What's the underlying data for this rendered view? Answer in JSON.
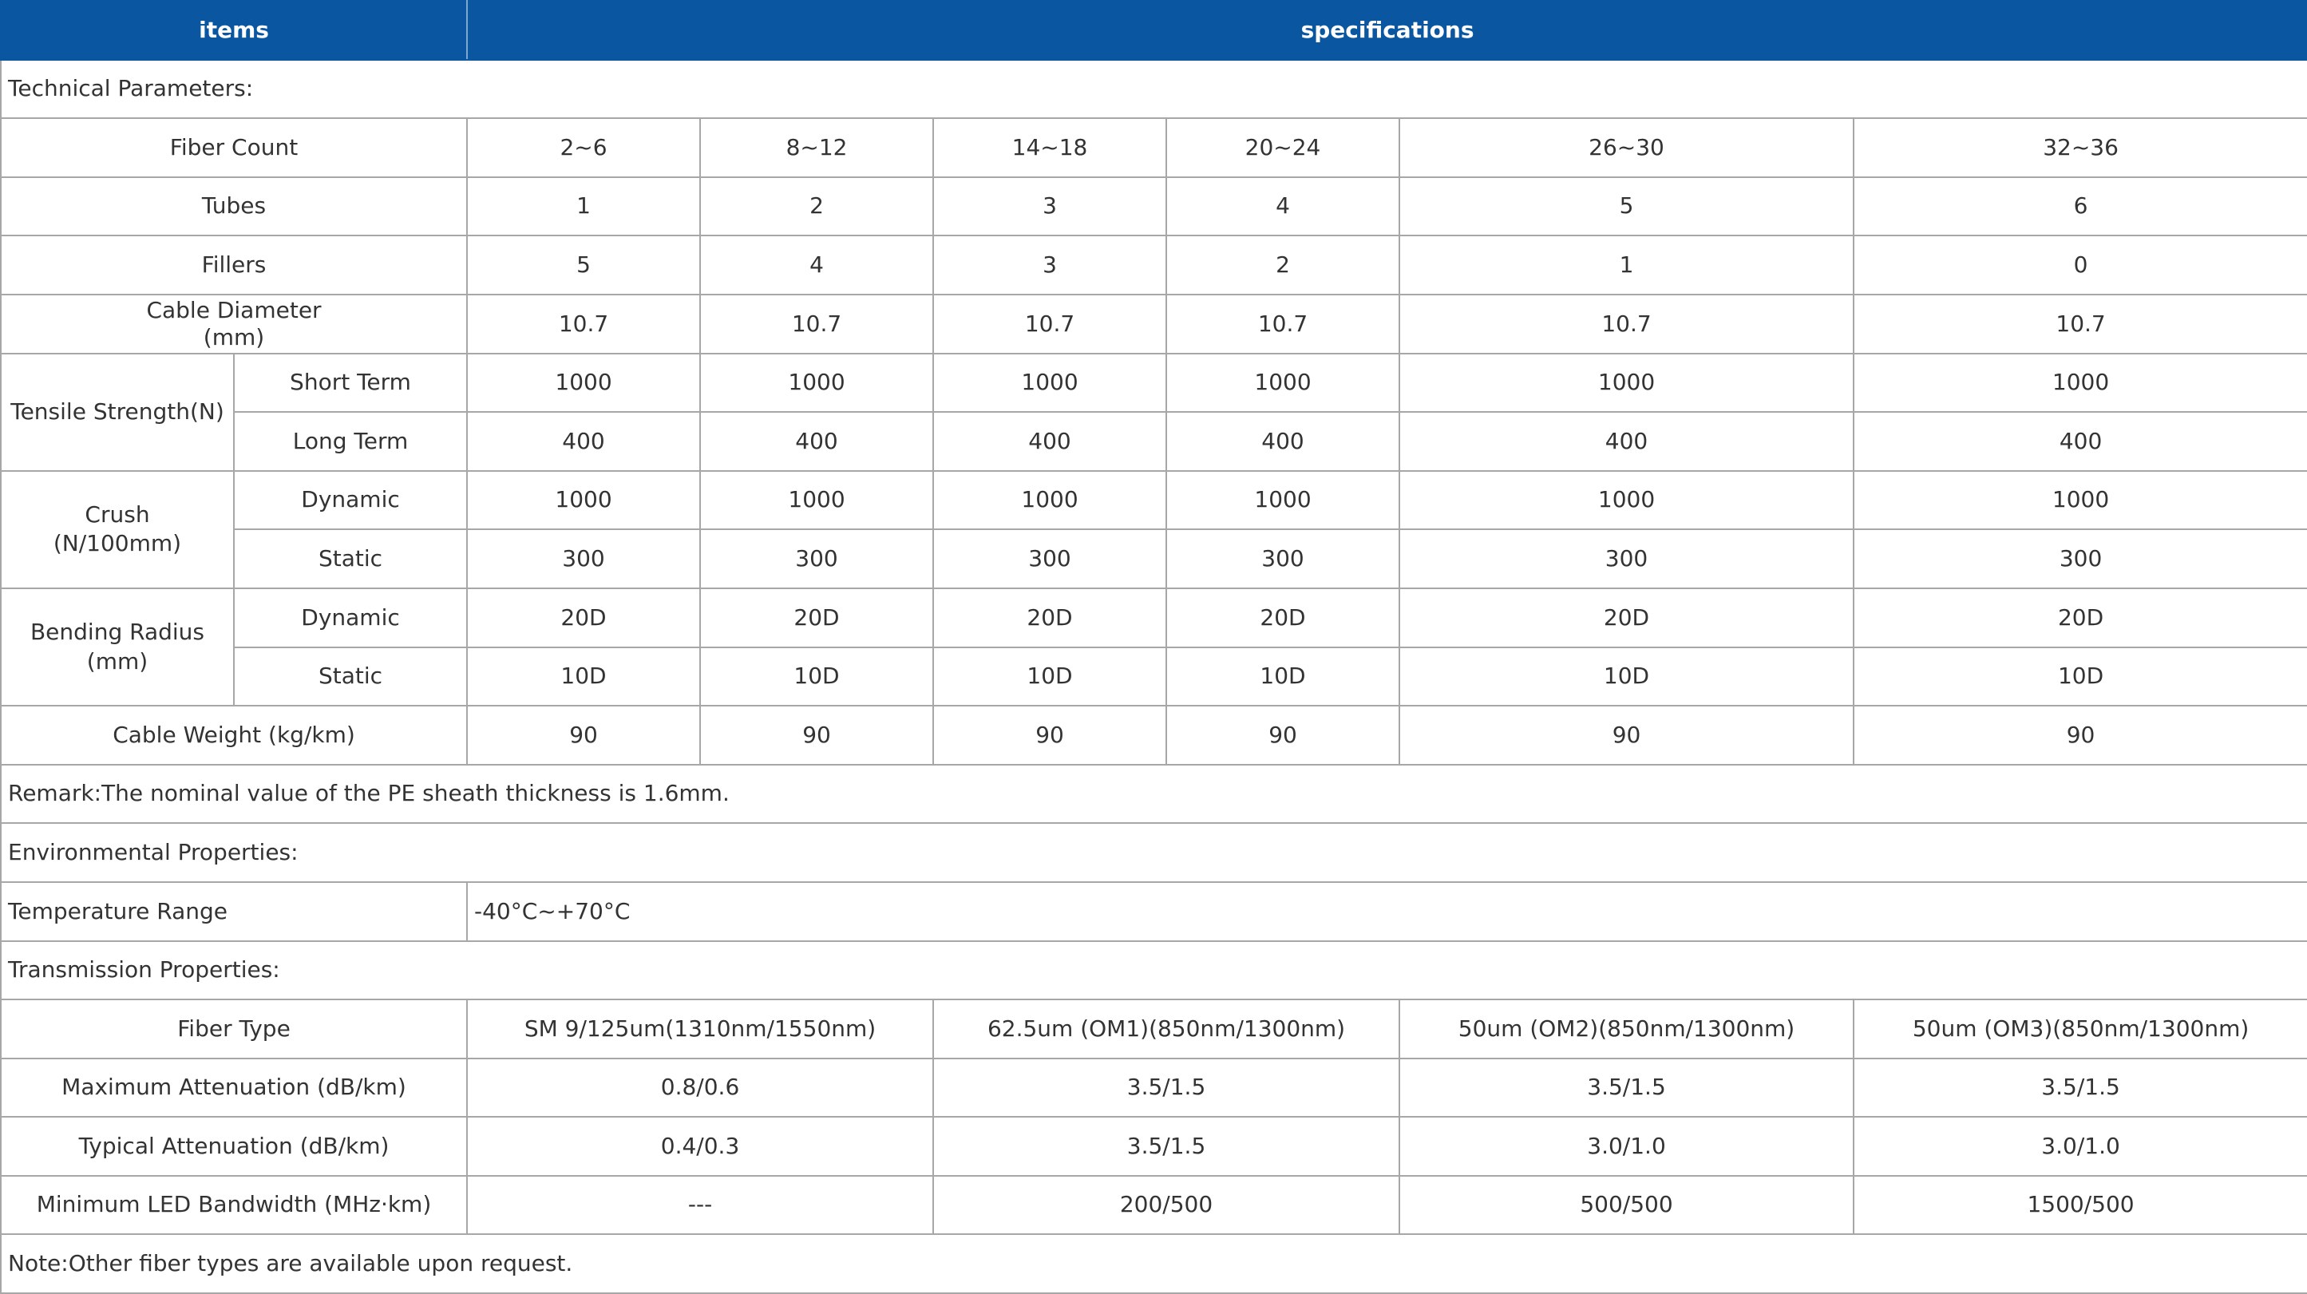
{
  "header": {
    "items": "items",
    "specifications": "specifications"
  },
  "sections": {
    "technical": "Technical Parameters:",
    "remark": "Remark:The nominal value of the PE sheath thickness is 1.6mm.",
    "environmental": "Environmental Properties:",
    "transmission": "Transmission Properties:",
    "note": "Note:Other fiber types are available upon request."
  },
  "technical": {
    "fiber_count": {
      "label": "Fiber Count",
      "values": [
        "2~6",
        "8~12",
        "14~18",
        "20~24",
        "26~30",
        "32~36"
      ]
    },
    "tubes": {
      "label": "Tubes",
      "values": [
        "1",
        "2",
        "3",
        "4",
        "5",
        "6"
      ]
    },
    "fillers": {
      "label": "Fillers",
      "values": [
        "5",
        "4",
        "3",
        "2",
        "1",
        "0"
      ]
    },
    "cable_diameter": {
      "label_line1": "Cable Diameter",
      "label_line2": "(mm)",
      "values": [
        "10.7",
        "10.7",
        "10.7",
        "10.7",
        "10.7",
        "10.7"
      ]
    },
    "tensile": {
      "label": "Tensile Strength(N)",
      "short": {
        "label": "Short Term",
        "values": [
          "1000",
          "1000",
          "1000",
          "1000",
          "1000",
          "1000"
        ]
      },
      "long": {
        "label": "Long Term",
        "values": [
          "400",
          "400",
          "400",
          "400",
          "400",
          "400"
        ]
      }
    },
    "crush": {
      "label_line1": "Crush",
      "label_line2": "(N/100mm)",
      "dynamic": {
        "label": "Dynamic",
        "values": [
          "1000",
          "1000",
          "1000",
          "1000",
          "1000",
          "1000"
        ]
      },
      "static": {
        "label": "Static",
        "values": [
          "300",
          "300",
          "300",
          "300",
          "300",
          "300"
        ]
      }
    },
    "bending": {
      "label_line1": "Bending Radius",
      "label_line2": "(mm)",
      "dynamic": {
        "label": "Dynamic",
        "values": [
          "20D",
          "20D",
          "20D",
          "20D",
          "20D",
          "20D"
        ]
      },
      "static": {
        "label": "Static",
        "values": [
          "10D",
          "10D",
          "10D",
          "10D",
          "10D",
          "10D"
        ]
      }
    },
    "weight": {
      "label": "Cable Weight (kg/km)",
      "values": [
        "90",
        "90",
        "90",
        "90",
        "90",
        "90"
      ]
    }
  },
  "environmental": {
    "temperature": {
      "label": "Temperature Range",
      "value": "-40°C~+70°C"
    }
  },
  "transmission": {
    "fiber_type": {
      "label": "Fiber Type",
      "values": [
        "SM 9/125um(1310nm/1550nm)",
        "62.5um (OM1)(850nm/1300nm)",
        "50um (OM2)(850nm/1300nm)",
        "50um (OM3)(850nm/1300nm)"
      ]
    },
    "max_attenuation": {
      "label": "Maximum Attenuation (dB/km)",
      "values": [
        "0.8/0.6",
        "3.5/1.5",
        "3.5/1.5",
        "3.5/1.5"
      ]
    },
    "typ_attenuation": {
      "label": "Typical Attenuation (dB/km)",
      "values": [
        "0.4/0.3",
        "3.5/1.5",
        "3.0/1.0",
        "3.0/1.0"
      ]
    },
    "bandwidth": {
      "label": "Minimum LED Bandwidth (MHz·km)",
      "values": [
        "---",
        "200/500",
        "500/500",
        "1500/500"
      ]
    }
  },
  "colors": {
    "header_bg": "#0a56a0",
    "header_text": "#ffffff",
    "border": "#a7a7a7",
    "text": "#333333"
  }
}
